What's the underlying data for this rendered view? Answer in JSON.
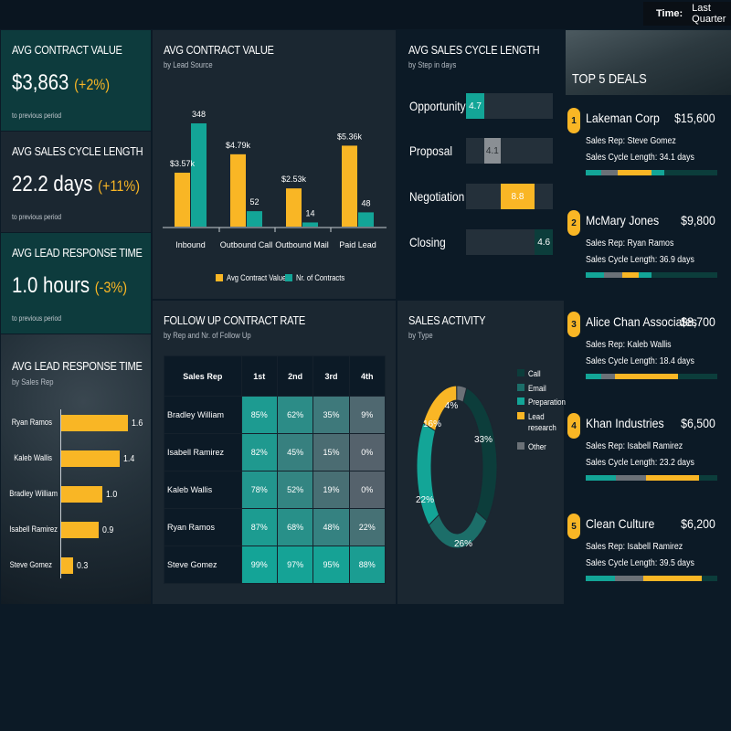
{
  "header": {
    "time_label": "Time:",
    "time_value": "Last Quarter"
  },
  "kpis": [
    {
      "title": "AVG CONTRACT VALUE",
      "value": "$3,863",
      "change": "(+2%)",
      "note": "to previous period"
    },
    {
      "title": "AVG SALES CYCLE LENGTH",
      "value": "22.2 days",
      "change": "(+11%)",
      "note": "to previous period"
    },
    {
      "title": "AVG LEAD RESPONSE TIME",
      "value": "1.0 hours",
      "change": "(-3%)",
      "note": "to previous period"
    }
  ],
  "response_by_rep": {
    "title": "AVG LEAD RESPONSE TIME",
    "subtitle": "by Sales Rep",
    "reps": [
      {
        "name": "Ryan Ramos",
        "value": "1.6"
      },
      {
        "name": "Kaleb Wallis",
        "value": "1.4"
      },
      {
        "name": "Bradley William",
        "value": "1.0"
      },
      {
        "name": "Isabell Ramirez",
        "value": "0.9"
      },
      {
        "name": "Steve Gomez",
        "value": "0.3"
      }
    ]
  },
  "contract_value": {
    "title": "AVG CONTRACT VALUE",
    "subtitle": "by Lead Source",
    "legend": [
      "Avg Contract Value",
      "Nr. of Contracts"
    ],
    "sources": [
      {
        "name": "Inbound",
        "value_label": "$3.57k",
        "contracts": "348"
      },
      {
        "name": "Outbound Call",
        "value_label": "$4.79k",
        "contracts": "52"
      },
      {
        "name": "Outbound Mail",
        "value_label": "$2.53k",
        "contracts": "14"
      },
      {
        "name": "Paid Lead",
        "value_label": "$5.36k",
        "contracts": "48"
      }
    ]
  },
  "cycle_length": {
    "title": "AVG SALES CYCLE LENGTH",
    "subtitle": "by Step in days",
    "steps": [
      {
        "name": "Opportunity",
        "value": "4.7"
      },
      {
        "name": "Proposal",
        "value": "4.1"
      },
      {
        "name": "Negotiation",
        "value": "8.8"
      },
      {
        "name": "Closing",
        "value": "4.6"
      }
    ]
  },
  "top_deals": {
    "title": "TOP 5 DEALS",
    "deals": [
      {
        "rank": "1",
        "company": "Lakeman Corp",
        "amount": "$15,600",
        "rep": "Sales Rep: Steve Gomez",
        "cycle": "Sales Cycle Length: 34.1 days"
      },
      {
        "rank": "2",
        "company": "McMary Jones",
        "amount": "$9,800",
        "rep": "Sales Rep: Ryan Ramos",
        "cycle": "Sales Cycle Length: 36.9 days"
      },
      {
        "rank": "3",
        "company": "Alice Chan Associates",
        "amount": "$8,700",
        "rep": "Sales Rep: Kaleb Wallis",
        "cycle": "Sales Cycle Length: 18.4 days"
      },
      {
        "rank": "4",
        "company": "Khan Industries",
        "amount": "$6,500",
        "rep": "Sales Rep: Isabell Ramirez",
        "cycle": "Sales Cycle Length: 23.2 days"
      },
      {
        "rank": "5",
        "company": "Clean Culture",
        "amount": "$6,200",
        "rep": "Sales Rep: Isabell Ramirez",
        "cycle": "Sales Cycle Length: 39.5 days"
      }
    ]
  },
  "follow_up": {
    "title": "FOLLOW UP CONTRACT RATE",
    "subtitle": "by Rep and Nr. of Follow Up",
    "headers": [
      "Sales Rep",
      "1st",
      "2nd",
      "3rd",
      "4th"
    ],
    "rows": [
      {
        "name": "Bradley William",
        "cells": [
          "85%",
          "62%",
          "35%",
          "9%"
        ]
      },
      {
        "name": "Isabell Ramirez",
        "cells": [
          "82%",
          "45%",
          "15%",
          "0%"
        ]
      },
      {
        "name": "Kaleb Wallis",
        "cells": [
          "78%",
          "52%",
          "19%",
          "0%"
        ]
      },
      {
        "name": "Ryan Ramos",
        "cells": [
          "87%",
          "68%",
          "48%",
          "22%"
        ]
      },
      {
        "name": "Steve Gomez",
        "cells": [
          "99%",
          "97%",
          "95%",
          "88%"
        ]
      }
    ]
  },
  "sales_activity": {
    "title": "SALES ACTIVITY",
    "subtitle": "by Type",
    "legend": [
      "Call",
      "Email",
      "Preparation",
      "Lead research",
      "Other"
    ],
    "slice_labels": [
      "33%",
      "26%",
      "22%",
      "16%",
      "4%"
    ]
  },
  "colors": {
    "accent_yellow": "#f9b625",
    "accent_teal": "#13a597",
    "panel": "#1b2731",
    "panel_teal": "#0c3a3c"
  },
  "chart_data": [
    {
      "type": "bar",
      "title": "AVG LEAD RESPONSE TIME",
      "subtitle": "by Sales Rep",
      "orientation": "horizontal",
      "categories": [
        "Ryan Ramos",
        "Kaleb Wallis",
        "Bradley William",
        "Isabell Ramirez",
        "Steve Gomez"
      ],
      "values": [
        1.6,
        1.4,
        1.0,
        0.9,
        0.3
      ],
      "xlim": [
        0,
        1.6
      ]
    },
    {
      "type": "bar",
      "title": "AVG CONTRACT VALUE",
      "subtitle": "by Lead Source",
      "categories": [
        "Inbound",
        "Outbound Call",
        "Outbound Mail",
        "Paid Lead"
      ],
      "series": [
        {
          "name": "Avg Contract Value",
          "values": [
            3570,
            4790,
            2530,
            5360
          ]
        },
        {
          "name": "Nr. of Contracts",
          "values": [
            348,
            52,
            14,
            48
          ]
        }
      ],
      "legend": "bottom"
    },
    {
      "type": "bar",
      "title": "AVG SALES CYCLE LENGTH",
      "subtitle": "by Step in days",
      "orientation": "horizontal",
      "categories": [
        "Opportunity",
        "Proposal",
        "Negotiation",
        "Closing"
      ],
      "start": [
        0,
        4.7,
        8.8,
        17.6
      ],
      "values": [
        4.7,
        4.1,
        8.8,
        4.6
      ],
      "xlim": [
        0,
        22.2
      ]
    },
    {
      "type": "pie",
      "title": "SALES ACTIVITY",
      "subtitle": "by Type",
      "categories": [
        "Call",
        "Email",
        "Preparation",
        "Lead research",
        "Other"
      ],
      "values": [
        33,
        26,
        22,
        16,
        4
      ],
      "colors": [
        "#0c3d3b",
        "#1c6e69",
        "#13a597",
        "#f9b625",
        "#6b7177"
      ],
      "legend": "right"
    },
    {
      "type": "heatmap",
      "title": "FOLLOW UP CONTRACT RATE",
      "subtitle": "by Rep and Nr. of Follow Up",
      "rows": [
        "Bradley William",
        "Isabell Ramirez",
        "Kaleb Wallis",
        "Ryan Ramos",
        "Steve Gomez"
      ],
      "columns": [
        "1st",
        "2nd",
        "3rd",
        "4th"
      ],
      "values": [
        [
          85,
          62,
          35,
          9
        ],
        [
          82,
          45,
          15,
          0
        ],
        [
          78,
          52,
          19,
          0
        ],
        [
          87,
          68,
          48,
          22
        ],
        [
          99,
          97,
          95,
          88
        ]
      ]
    }
  ]
}
